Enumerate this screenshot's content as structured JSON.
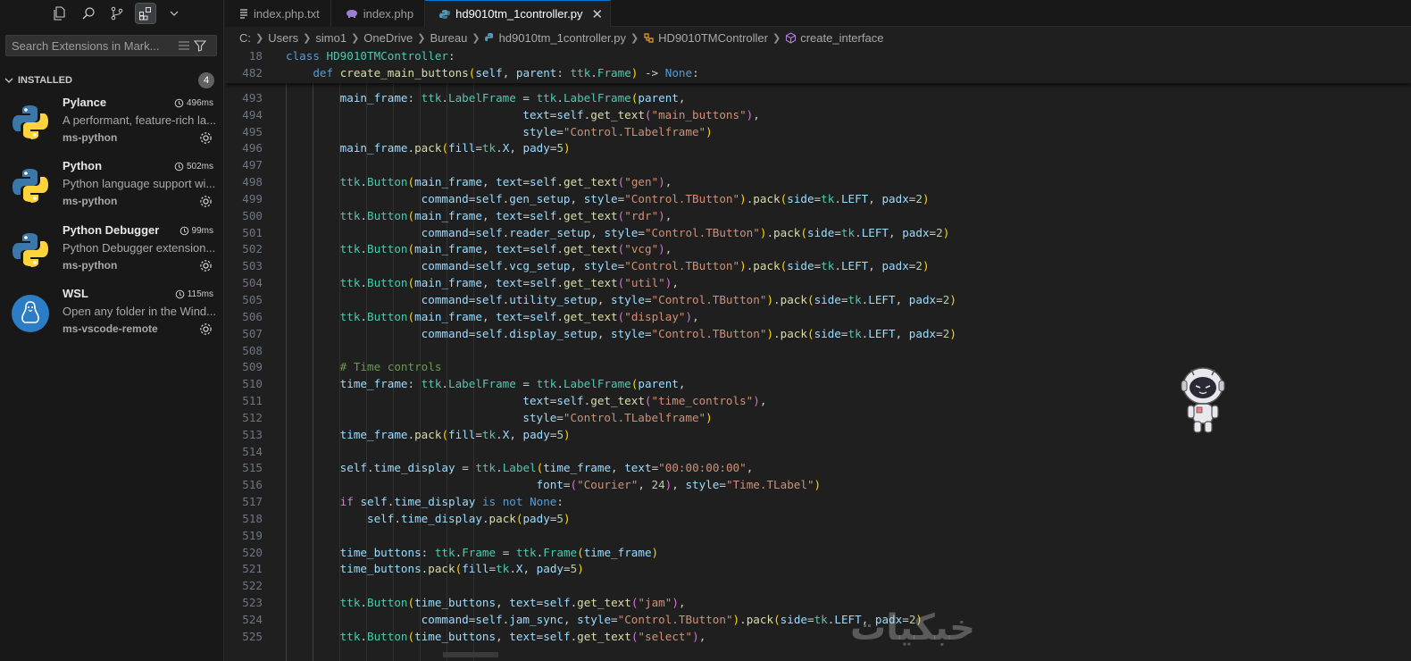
{
  "sidebar": {
    "search_placeholder": "Search Extensions in Mark...",
    "section_title": "INSTALLED",
    "section_count": "4",
    "extensions": [
      {
        "name": "Pylance",
        "time": "496ms",
        "description": "A performant, feature-rich la...",
        "publisher": "ms-python",
        "icon": "python-logo-icon"
      },
      {
        "name": "Python",
        "time": "502ms",
        "description": "Python language support wi...",
        "publisher": "ms-python",
        "icon": "python-logo-icon"
      },
      {
        "name": "Python Debugger",
        "time": "99ms",
        "description": "Python Debugger extension...",
        "publisher": "ms-python",
        "icon": "python-logo-icon"
      },
      {
        "name": "WSL",
        "time": "115ms",
        "description": "Open any folder in the Wind...",
        "publisher": "ms-vscode-remote",
        "icon": "linux-penguin-icon"
      }
    ]
  },
  "tabs": [
    {
      "label": "index.php.txt",
      "icon": "text-file-icon"
    },
    {
      "label": "index.php",
      "icon": "php-elephant-icon"
    },
    {
      "label": "hd9010tm_1controller.py",
      "icon": "python-file-icon",
      "active": true
    }
  ],
  "breadcrumb": [
    "C:",
    "Users",
    "simo1",
    "OneDrive",
    "Bureau",
    "hd9010tm_1controller.py",
    "HD9010TMController",
    "create_interface"
  ],
  "code": {
    "sticky": [
      {
        "n": "18",
        "html": "<span class='kw'>class</span> <span class='cls'>HD9010TMController</span>:"
      },
      {
        "n": "482",
        "html": "    <span class='kw'>def</span> <span class='fn'>create_main_buttons</span><span class='p1'>(</span><span class='var'>self</span>, <span class='var'>parent</span>: <span class='cls'>ttk</span>.<span class='cls'>Frame</span><span class='p1'>)</span> -> <span class='kw'>None</span>:"
      }
    ],
    "lines": [
      {
        "n": "493",
        "html": "        <span class='var'>main_frame</span>: <span class='cls'>ttk</span>.<span class='cls'>LabelFrame</span> = <span class='cls'>ttk</span>.<span class='cls'>LabelFrame</span><span class='p1'>(</span><span class='var'>parent</span>,"
      },
      {
        "n": "494",
        "html": "                                   <span class='var'>text</span>=<span class='var'>self</span>.<span class='fn'>get_text</span><span class='p2'>(</span><span class='str'>\"main_buttons\"</span><span class='p2'>)</span>,"
      },
      {
        "n": "495",
        "html": "                                   <span class='var'>style</span>=<span class='str'>\"Control.TLabelframe\"</span><span class='p1'>)</span>"
      },
      {
        "n": "496",
        "html": "        <span class='var'>main_frame</span>.<span class='fn'>pack</span><span class='p1'>(</span><span class='var'>fill</span>=<span class='cls'>tk</span>.<span class='var'>X</span>, <span class='var'>pady</span>=<span class='num'>5</span><span class='p1'>)</span>"
      },
      {
        "n": "497",
        "html": ""
      },
      {
        "n": "498",
        "html": "        <span class='cls'>ttk</span>.<span class='cls'>Button</span><span class='p1'>(</span><span class='var'>main_frame</span>, <span class='var'>text</span>=<span class='var'>self</span>.<span class='fn'>get_text</span><span class='p2'>(</span><span class='str'>\"gen\"</span><span class='p2'>)</span>,"
      },
      {
        "n": "499",
        "html": "                    <span class='var'>command</span>=<span class='var'>self</span>.<span class='var'>gen_setup</span>, <span class='var'>style</span>=<span class='str'>\"Control.TButton\"</span><span class='p1'>)</span>.<span class='fn'>pack</span><span class='p1'>(</span><span class='var'>side</span>=<span class='cls'>tk</span>.<span class='var'>LEFT</span>, <span class='var'>padx</span>=<span class='num'>2</span><span class='p1'>)</span>"
      },
      {
        "n": "500",
        "html": "        <span class='cls'>ttk</span>.<span class='cls'>Button</span><span class='p1'>(</span><span class='var'>main_frame</span>, <span class='var'>text</span>=<span class='var'>self</span>.<span class='fn'>get_text</span><span class='p2'>(</span><span class='str'>\"rdr\"</span><span class='p2'>)</span>,"
      },
      {
        "n": "501",
        "html": "                    <span class='var'>command</span>=<span class='var'>self</span>.<span class='var'>reader_setup</span>, <span class='var'>style</span>=<span class='str'>\"Control.TButton\"</span><span class='p1'>)</span>.<span class='fn'>pack</span><span class='p1'>(</span><span class='var'>side</span>=<span class='cls'>tk</span>.<span class='var'>LEFT</span>, <span class='var'>padx</span>=<span class='num'>2</span><span class='p1'>)</span>"
      },
      {
        "n": "502",
        "html": "        <span class='cls'>ttk</span>.<span class='cls'>Button</span><span class='p1'>(</span><span class='var'>main_frame</span>, <span class='var'>text</span>=<span class='var'>self</span>.<span class='fn'>get_text</span><span class='p2'>(</span><span class='str'>\"vcg\"</span><span class='p2'>)</span>,"
      },
      {
        "n": "503",
        "html": "                    <span class='var'>command</span>=<span class='var'>self</span>.<span class='var'>vcg_setup</span>, <span class='var'>style</span>=<span class='str'>\"Control.TButton\"</span><span class='p1'>)</span>.<span class='fn'>pack</span><span class='p1'>(</span><span class='var'>side</span>=<span class='cls'>tk</span>.<span class='var'>LEFT</span>, <span class='var'>padx</span>=<span class='num'>2</span><span class='p1'>)</span>"
      },
      {
        "n": "504",
        "html": "        <span class='cls'>ttk</span>.<span class='cls'>Button</span><span class='p1'>(</span><span class='var'>main_frame</span>, <span class='var'>text</span>=<span class='var'>self</span>.<span class='fn'>get_text</span><span class='p2'>(</span><span class='str'>\"util\"</span><span class='p2'>)</span>,"
      },
      {
        "n": "505",
        "html": "                    <span class='var'>command</span>=<span class='var'>self</span>.<span class='var'>utility_setup</span>, <span class='var'>style</span>=<span class='str'>\"Control.TButton\"</span><span class='p1'>)</span>.<span class='fn'>pack</span><span class='p1'>(</span><span class='var'>side</span>=<span class='cls'>tk</span>.<span class='var'>LEFT</span>, <span class='var'>padx</span>=<span class='num'>2</span><span class='p1'>)</span>"
      },
      {
        "n": "506",
        "html": "        <span class='cls'>ttk</span>.<span class='cls'>Button</span><span class='p1'>(</span><span class='var'>main_frame</span>, <span class='var'>text</span>=<span class='var'>self</span>.<span class='fn'>get_text</span><span class='p2'>(</span><span class='str'>\"display\"</span><span class='p2'>)</span>,"
      },
      {
        "n": "507",
        "html": "                    <span class='var'>command</span>=<span class='var'>self</span>.<span class='var'>display_setup</span>, <span class='var'>style</span>=<span class='str'>\"Control.TButton\"</span><span class='p1'>)</span>.<span class='fn'>pack</span><span class='p1'>(</span><span class='var'>side</span>=<span class='cls'>tk</span>.<span class='var'>LEFT</span>, <span class='var'>padx</span>=<span class='num'>2</span><span class='p1'>)</span>"
      },
      {
        "n": "508",
        "html": ""
      },
      {
        "n": "509",
        "html": "        <span class='cm'># Time controls</span>"
      },
      {
        "n": "510",
        "html": "        <span class='var'>time_frame</span>: <span class='cls'>ttk</span>.<span class='cls'>LabelFrame</span> = <span class='cls'>ttk</span>.<span class='cls'>LabelFrame</span><span class='p1'>(</span><span class='var'>parent</span>,"
      },
      {
        "n": "511",
        "html": "                                   <span class='var'>text</span>=<span class='var'>self</span>.<span class='fn'>get_text</span><span class='p2'>(</span><span class='str'>\"time_controls\"</span><span class='p2'>)</span>,"
      },
      {
        "n": "512",
        "html": "                                   <span class='var'>style</span>=<span class='str'>\"Control.TLabelframe\"</span><span class='p1'>)</span>"
      },
      {
        "n": "513",
        "html": "        <span class='var'>time_frame</span>.<span class='fn'>pack</span><span class='p1'>(</span><span class='var'>fill</span>=<span class='cls'>tk</span>.<span class='var'>X</span>, <span class='var'>pady</span>=<span class='num'>5</span><span class='p1'>)</span>"
      },
      {
        "n": "514",
        "html": ""
      },
      {
        "n": "515",
        "html": "        <span class='var'>self</span>.<span class='var'>time_display</span> = <span class='cls'>ttk</span>.<span class='cls'>Label</span><span class='p1'>(</span><span class='var'>time_frame</span>, <span class='var'>text</span>=<span class='str'>\"00:00:00:00\"</span>,"
      },
      {
        "n": "516",
        "html": "                                     <span class='var'>font</span>=<span class='p2'>(</span><span class='str'>\"Courier\"</span>, <span class='num'>24</span><span class='p2'>)</span>, <span class='var'>style</span>=<span class='str'>\"Time.TLabel\"</span><span class='p1'>)</span>"
      },
      {
        "n": "517",
        "html": "        <span class='kw2'>if</span> <span class='var'>self</span>.<span class='var'>time_display</span> <span class='kw'>is not</span> <span class='kw'>None</span>:"
      },
      {
        "n": "518",
        "html": "            <span class='var'>self</span>.<span class='var'>time_display</span>.<span class='fn'>pack</span><span class='p1'>(</span><span class='var'>pady</span>=<span class='num'>5</span><span class='p1'>)</span>"
      },
      {
        "n": "519",
        "html": ""
      },
      {
        "n": "520",
        "html": "        <span class='var'>time_buttons</span>: <span class='cls'>ttk</span>.<span class='cls'>Frame</span> = <span class='cls'>ttk</span>.<span class='cls'>Frame</span><span class='p1'>(</span><span class='var'>time_frame</span><span class='p1'>)</span>"
      },
      {
        "n": "521",
        "html": "        <span class='var'>time_buttons</span>.<span class='fn'>pack</span><span class='p1'>(</span><span class='var'>fill</span>=<span class='cls'>tk</span>.<span class='var'>X</span>, <span class='var'>pady</span>=<span class='num'>5</span><span class='p1'>)</span>"
      },
      {
        "n": "522",
        "html": ""
      },
      {
        "n": "523",
        "html": "        <span class='cls'>ttk</span>.<span class='cls'>Button</span><span class='p1'>(</span><span class='var'>time_buttons</span>, <span class='var'>text</span>=<span class='var'>self</span>.<span class='fn'>get_text</span><span class='p2'>(</span><span class='str'>\"jam\"</span><span class='p2'>)</span>,"
      },
      {
        "n": "524",
        "html": "                    <span class='var'>command</span>=<span class='var'>self</span>.<span class='var'>jam_sync</span>, <span class='var'>style</span>=<span class='str'>\"Control.TButton\"</span><span class='p1'>)</span>.<span class='fn'>pack</span><span class='p1'>(</span><span class='var'>side</span>=<span class='cls'>tk</span>.<span class='var'>LEFT</span>, <span class='var'>padx</span>=<span class='num'>2</span><span class='p1'>)</span>"
      },
      {
        "n": "525",
        "html": "        <span class='cls'>ttk</span>.<span class='cls'>Button</span><span class='p1'>(</span><span class='var'>time_buttons</span>, <span class='var'>text</span>=<span class='var'>self</span>.<span class='fn'>get_text</span><span class='p2'>(</span><span class='str'>\"select\"</span><span class='p2'>)</span>,"
      }
    ]
  },
  "watermark": "خبكيات",
  "colors": {
    "accent": "#0078d4",
    "background": "#1f1f1f",
    "sidebar": "#181818"
  }
}
